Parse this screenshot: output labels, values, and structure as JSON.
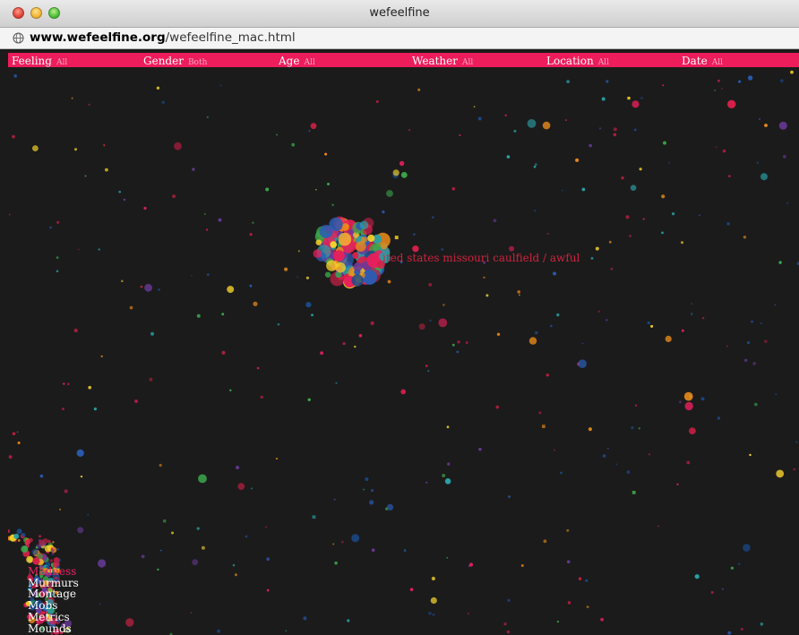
{
  "window": {
    "title": "wefeelfine"
  },
  "urlbar": {
    "host": "www.wefeelfine.org",
    "path": "/wefeelfine_mac.html"
  },
  "filters": [
    {
      "label": "Feeling",
      "value": "All"
    },
    {
      "label": "Gender",
      "value": "Both"
    },
    {
      "label": "Age",
      "value": "All"
    },
    {
      "label": "Weather",
      "value": "All"
    },
    {
      "label": "Location",
      "value": "All"
    },
    {
      "label": "Date",
      "value": "All"
    }
  ],
  "caption": "ited states missouri caulfield / awful",
  "movements": [
    {
      "label": "Madness",
      "active": true
    },
    {
      "label": "Murmurs",
      "active": false
    },
    {
      "label": "Montage",
      "active": false
    },
    {
      "label": "Mobs",
      "active": false
    },
    {
      "label": "Metrics",
      "active": false
    },
    {
      "label": "Mounds",
      "active": false
    }
  ],
  "colors": {
    "accent": "#ed1c5b",
    "background": "#1b1b1b",
    "particle_palette": [
      "#e8205c",
      "#d81f4a",
      "#f5d22a",
      "#2aa0a6",
      "#6a3a9a",
      "#2b5cb3",
      "#e98a1a",
      "#3aa84a",
      "#b02040",
      "#1a4a8a"
    ]
  }
}
